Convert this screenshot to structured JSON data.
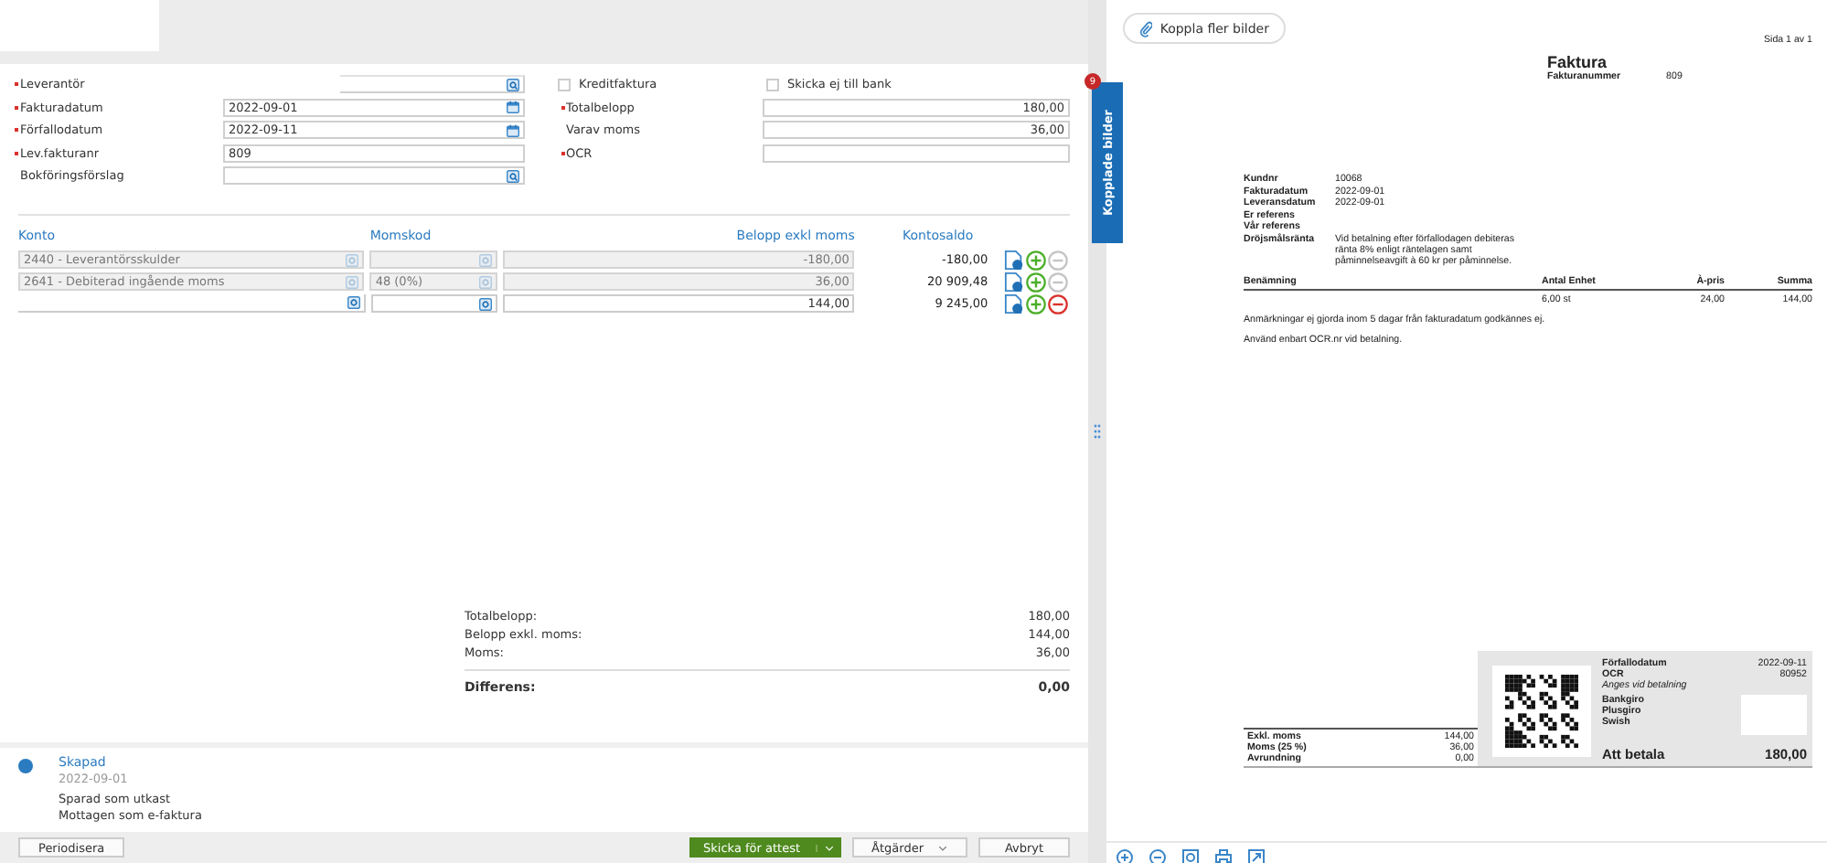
{
  "form": {
    "left_fields": [
      {
        "label": "Leverantör",
        "required": true,
        "kind": "lookup"
      },
      {
        "label": "Fakturadatum",
        "required": true,
        "value": "2022-09-01",
        "kind": "date"
      },
      {
        "label": "Förfallodatum",
        "required": true,
        "value": "2022-09-11",
        "kind": "date"
      },
      {
        "label": "Lev.fakturanr",
        "required": true,
        "value": "809",
        "kind": "text"
      },
      {
        "label": "Bokföringsförslag",
        "required": false,
        "kind": "lookup"
      }
    ],
    "checkboxes": [
      {
        "label": "Kreditfaktura",
        "checked": false
      },
      {
        "label": "Skicka ej till bank",
        "checked": false
      }
    ],
    "right_fields": [
      {
        "label": "Totalbelopp",
        "required": true,
        "value": "180,00"
      },
      {
        "label": "Varav moms",
        "required": false,
        "value": "36,00"
      },
      {
        "label": "OCR",
        "required": true
      }
    ]
  },
  "accounting": {
    "columns": [
      "Konto",
      "Momskod",
      "Belopp exkl moms",
      "Kontosaldo"
    ],
    "rows": [
      {
        "konto": "2440 - Leverantörsskulder",
        "momskod": "",
        "amount": "-180,00",
        "balance": "-180,00",
        "disabled": true,
        "removable": false
      },
      {
        "konto": "2641 - Debiterad ingående moms",
        "momskod": "48 (0%)",
        "amount": "36,00",
        "balance": "20 909,48",
        "disabled": true,
        "removable": false
      },
      {
        "konto": "",
        "momskod": "",
        "amount": "144,00",
        "balance": "9 245,00",
        "disabled": false,
        "removable": true
      }
    ]
  },
  "summary": {
    "lines": [
      {
        "label": "Totalbelopp:",
        "value": "180,00"
      },
      {
        "label": "Belopp exkl. moms:",
        "value": "144,00"
      },
      {
        "label": "Moms:",
        "value": "36,00"
      }
    ],
    "difference": {
      "label": "Differens:",
      "value": "0,00"
    }
  },
  "history": {
    "title": "Skapad",
    "date": "2022-09-01",
    "lines": [
      "Sparad som utkast",
      "Mottagen som e-faktura"
    ]
  },
  "footer": {
    "left_button": "Periodisera",
    "primary_button": "Skicka för attest",
    "actions_button": "Åtgärder",
    "cancel_button": "Avbryt"
  },
  "viewer": {
    "attach_button": "Koppla fler bilder",
    "side_tab": {
      "label": "Kopplade bilder",
      "badge": "9"
    },
    "document": {
      "page": "Sida 1 av 1",
      "title": "Faktura",
      "number_label": "Fakturanummer",
      "number": "809",
      "info": [
        {
          "label": "Kundnr",
          "value": "10068"
        },
        {
          "label": "Fakturadatum",
          "value": "2022-09-01"
        },
        {
          "label": "Leveransdatum",
          "value": "2022-09-01"
        },
        {
          "label": "Er referens"
        },
        {
          "label": "Vår referens"
        },
        {
          "label": "Dröjsmålsränta",
          "value": "Vid betalning efter förfallodagen debiteras ränta 8% enligt räntelagen samt påminnelseavgift à 60 kr per påminnelse."
        }
      ],
      "columns": [
        "Benämning",
        "Antal Enhet",
        "À-pris",
        "Summa"
      ],
      "items": [
        {
          "quantity": "6,00 st",
          "price": "24,00",
          "sum": "144,00"
        }
      ],
      "notes": [
        "Anmärkningar ej gjorda inom 5 dagar från fakturadatum godkännes ej.",
        "Använd enbart OCR.nr vid betalning."
      ],
      "totals": [
        {
          "label": "Exkl. moms",
          "value": "144,00"
        },
        {
          "label": "Moms (25 %)",
          "value": "36,00"
        },
        {
          "label": "Avrundning",
          "value": "0,00"
        }
      ],
      "payment": {
        "rows": [
          {
            "label": "Förfallodatum",
            "value": "2022-09-11"
          },
          {
            "label": "OCR",
            "value": "80952"
          }
        ],
        "hint": "Anges vid betalning",
        "methods": [
          "Bankgiro",
          "Plusgiro",
          "Swish"
        ],
        "due_label": "Att betala",
        "due": "180,00"
      }
    }
  }
}
